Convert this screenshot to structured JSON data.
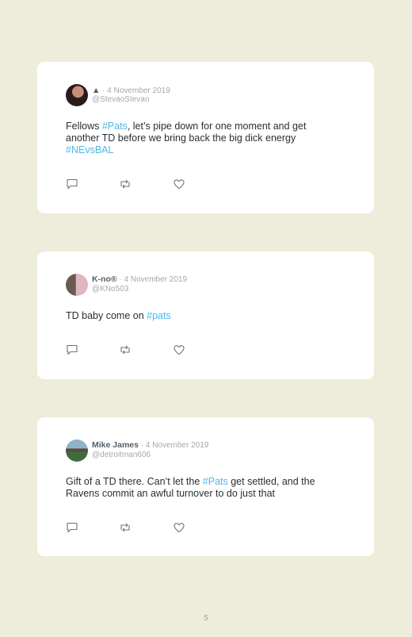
{
  "tweets": [
    {
      "name": "▲",
      "separator": " · ",
      "date": "4 November 2019",
      "handle": "@StevaoStevao",
      "text_parts": [
        {
          "t": "Fellows ",
          "tag": false
        },
        {
          "t": "#Pats",
          "tag": true
        },
        {
          "t": ", let’s pipe down for one moment and get another TD before we bring back the big dick energy ",
          "tag": false
        },
        {
          "t": "#NEvsBAL",
          "tag": true
        }
      ],
      "avatar_colors": [
        "#2a1a1a",
        "#c98d7a"
      ]
    },
    {
      "name": "K-no®",
      "separator": " · ",
      "date": "4 November 2019",
      "handle": "@KNo503",
      "text_parts": [
        {
          "t": "TD baby come on ",
          "tag": false
        },
        {
          "t": "#pats",
          "tag": true
        }
      ],
      "avatar_colors": [
        "#6b5a52",
        "#e0b7bf"
      ]
    },
    {
      "name": "Mike James",
      "separator": " · ",
      "date": "4 November 2019",
      "handle": "@detroitman606",
      "text_parts": [
        {
          "t": "Gift of a TD there. Can’t let the ",
          "tag": false
        },
        {
          "t": "#Pats",
          "tag": true
        },
        {
          "t": " get settled, and the Ravens commit an awful turnover to do just that",
          "tag": false
        }
      ],
      "avatar_colors": [
        "#3d6b3f",
        "#8fb3c9"
      ]
    }
  ],
  "actions": [
    "reply-icon",
    "retweet-icon",
    "like-icon"
  ],
  "page_number": "5"
}
